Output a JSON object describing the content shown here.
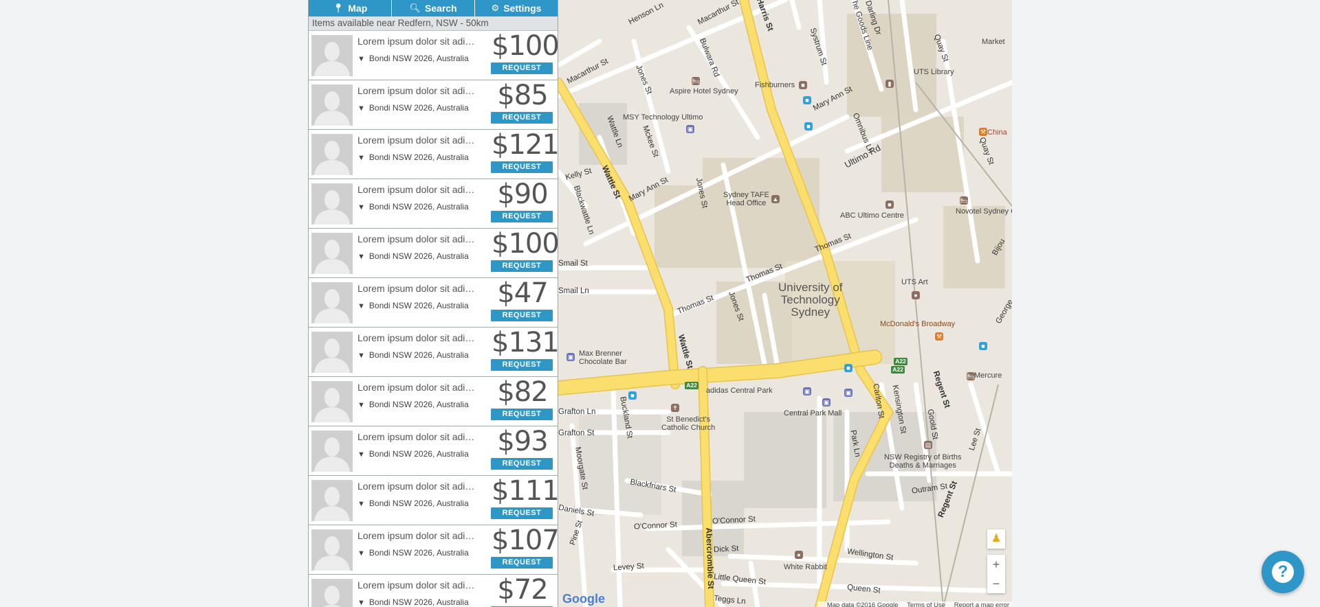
{
  "nav": {
    "map_label": "Map",
    "search_label": "Search",
    "settings_label": "Settings",
    "map_icon": "map-marker-icon",
    "search_icon": "search-icon",
    "settings_icon": "gear-icon"
  },
  "info_text": "Items available near Redfern, NSW - 50km",
  "items": [
    {
      "desc": "Lorem ipsum dolor sit adipiscing",
      "location": "Bondi NSW 2026, Australia",
      "price": "$100",
      "button": "REQUEST"
    },
    {
      "desc": "Lorem ipsum dolor sit adipiscing",
      "location": "Bondi NSW 2026, Australia",
      "price": "$85",
      "button": "REQUEST"
    },
    {
      "desc": "Lorem ipsum dolor sit adipiscing",
      "location": "Bondi NSW 2026, Australia",
      "price": "$121",
      "button": "REQUEST"
    },
    {
      "desc": "Lorem ipsum dolor sit adipiscing",
      "location": "Bondi NSW 2026, Australia",
      "price": "$90",
      "button": "REQUEST"
    },
    {
      "desc": "Lorem ipsum dolor sit adipiscing",
      "location": "Bondi NSW 2026, Australia",
      "price": "$100",
      "button": "REQUEST"
    },
    {
      "desc": "Lorem ipsum dolor sit adipiscing",
      "location": "Bondi NSW 2026, Australia",
      "price": "$47",
      "button": "REQUEST"
    },
    {
      "desc": "Lorem ipsum dolor sit adipiscing",
      "location": "Bondi NSW 2026, Australia",
      "price": "$131",
      "button": "REQUEST"
    },
    {
      "desc": "Lorem ipsum dolor sit adipiscing",
      "location": "Bondi NSW 2026, Australia",
      "price": "$82",
      "button": "REQUEST"
    },
    {
      "desc": "Lorem ipsum dolor sit adipiscing",
      "location": "Bondi NSW 2026, Australia",
      "price": "$93",
      "button": "REQUEST"
    },
    {
      "desc": "Lorem ipsum dolor sit adipiscing",
      "location": "Bondi NSW 2026, Australia",
      "price": "$111",
      "button": "REQUEST"
    },
    {
      "desc": "Lorem ipsum dolor sit adipiscing",
      "location": "Bondi NSW 2026, Australia",
      "price": "$107",
      "button": "REQUEST"
    },
    {
      "desc": "Lorem ipsum dolor sit adipiscing",
      "location": "Bondi NSW 2026, Australia",
      "price": "$72",
      "button": "REQUEST"
    }
  ],
  "map": {
    "places": {
      "aspire": "Aspire Hotel Sydney",
      "fishburners": "Fishburners",
      "uts_library": "UTS Library",
      "market": "Market",
      "msy": "MSY Technology Ultimo",
      "tafe": "Sydney TAFE\nHead Office",
      "abc": "ABC Ultimo Centre",
      "novotel": "Novotel Sydney C",
      "uts_art": "UTS Art",
      "uts": "University of\nTechnology\nSydney",
      "mcdonalds": "McDonald's Broadway",
      "max_brenner": "Max Brenner\nChocolate Bar",
      "adidas": "adidas Central Park",
      "central_park": "Central Park Mall",
      "st_benedicts": "St Benedict's\nCatholic Church",
      "mercure": "Mercure",
      "nsw_registry": "NSW Registry of Births\nDeaths & Marriages",
      "white_rabbit": "White Rabbit",
      "china": "China"
    },
    "streets": {
      "henson": "Henson Ln",
      "macarthur1": "Macarthur St",
      "macarthur2": "Macarthur St",
      "harris": "Harris St",
      "systrum": "Systrum St",
      "goods_line": "The Goods Line",
      "darling": "Darling Dr",
      "quay1": "Quay St",
      "quay2": "Quay St",
      "bulwara": "Bulwara Rd",
      "jones1": "Jones St",
      "jones2": "Jones St",
      "jones3": "Jones St",
      "mary_ann1": "Mary Ann St",
      "mary_ann2": "Mary Ann St",
      "omnibus": "Omnibus Ln",
      "ultimo_rd": "Ultimo Rd",
      "wattle_ln": "Wattle Ln",
      "mckee": "Mckee St",
      "wattle1": "Wattle St",
      "wattle2": "Wattle St",
      "kelly": "Kelly St",
      "blackwattle": "Blackwattle Ln",
      "thomas1": "Thomas St",
      "thomas2": "Thomas St",
      "thomas3": "Thomas St",
      "smail_st": "Smail St",
      "smail_ln": "Smail Ln",
      "bijou": "Bijou",
      "george": "George",
      "regent1": "Regent St",
      "regent2": "Regent St",
      "buckland": "Buckland St",
      "grafton_ln": "Grafton Ln",
      "grafton_st": "Grafton St",
      "carlton": "Carlton St",
      "kensington": "Kensington St",
      "goold": "Goold St",
      "lee": "Lee St",
      "park_ln": "Park Ln",
      "moorgate": "Moorgate St",
      "blackfriars": "Blackfriars St",
      "outram": "Outram St",
      "daniels": "Daniels St",
      "pine": "Pine St",
      "oconnor1": "O'Connor St",
      "oconnor2": "O'Connor St",
      "abercrombie": "Abercrombie St",
      "dick": "Dick St",
      "wellington": "Wellington St",
      "levey": "Levey St",
      "little_queen": "Little Queen St",
      "queen": "Queen St",
      "teggs": "Teggs Ln"
    },
    "shields": [
      "A22",
      "A22",
      "A22"
    ],
    "zoom_in": "+",
    "zoom_out": "−",
    "pegman_icon": "pegman-icon",
    "google_logo": "Google",
    "attribution": [
      "Map data ©2016 Google",
      "Terms of Use",
      "Report a map error"
    ]
  },
  "help_label": "?",
  "colors": {
    "accent": "#2f96c8",
    "road_major": "#fbdf6e",
    "map_bg": "#ebe7df",
    "block": "#ddd6c5"
  }
}
